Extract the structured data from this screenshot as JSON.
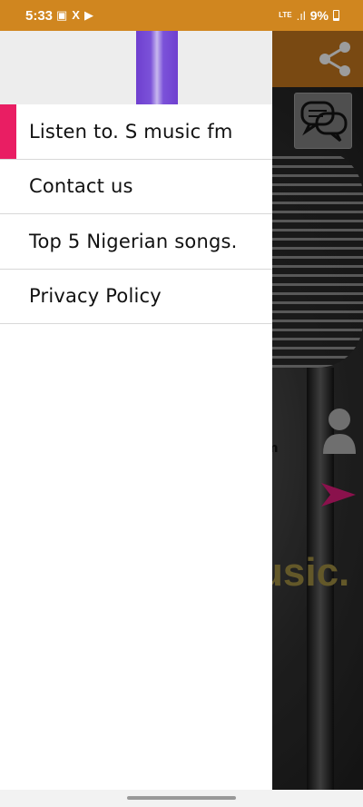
{
  "status_bar": {
    "time": "5:33",
    "left_icons": [
      "gallery-icon",
      "x-icon",
      "play-icon"
    ],
    "network": "LTE",
    "battery_percent": "9%"
  },
  "drawer": {
    "menu": [
      {
        "label": "Listen to. S music fm",
        "active": true
      },
      {
        "label": "Contact us",
        "active": false
      },
      {
        "label": "Top 5 Nigerian songs.",
        "active": false
      },
      {
        "label": "Privacy Policy",
        "active": false
      }
    ]
  },
  "background": {
    "brand_fragment": "usic.",
    "small_fragment": "m"
  },
  "colors": {
    "status_bar": "#d0861f",
    "active_indicator": "#e91e63",
    "header_stripe": "#7b52d9"
  }
}
